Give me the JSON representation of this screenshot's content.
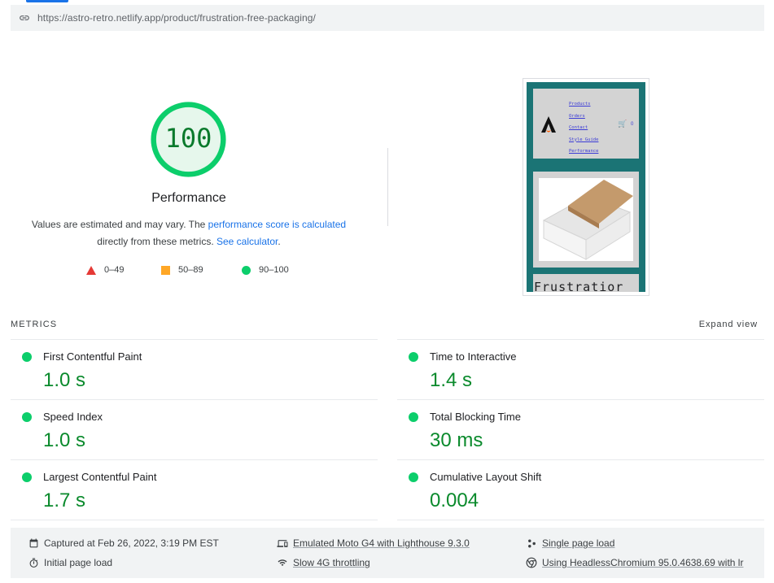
{
  "url": "https://astro-retro.netlify.app/product/frustration-free-packaging/",
  "score": {
    "value": "100",
    "fraction": 1.0,
    "title": "Performance",
    "desc_prefix": "Values are estimated and may vary. The ",
    "desc_link": "performance score is calculated",
    "desc_mid": "directly from these metrics. ",
    "desc_link2": "See calculator",
    "desc_suffix": "."
  },
  "legend": {
    "fail": "0–49",
    "average": "50–89",
    "pass": "90–100"
  },
  "colors": {
    "pass": "#0cce6b",
    "average": "#ffa726",
    "fail": "#e53935",
    "link": "#1a73e8",
    "score_text": "#0a7a2c"
  },
  "thumbnail": {
    "nav": [
      "Products",
      "Orders",
      "Contact",
      "Style Guide",
      "Performance"
    ],
    "cart_count": "0",
    "product_title": "Frustratior"
  },
  "metrics": {
    "header": "METRICS",
    "expand": "Expand view",
    "items": [
      {
        "label": "First Contentful Paint",
        "value": "1.0 s"
      },
      {
        "label": "Time to Interactive",
        "value": "1.4 s"
      },
      {
        "label": "Speed Index",
        "value": "1.0 s"
      },
      {
        "label": "Total Blocking Time",
        "value": "30 ms"
      },
      {
        "label": "Largest Contentful Paint",
        "value": "1.7 s"
      },
      {
        "label": "Cumulative Layout Shift",
        "value": "0.004"
      }
    ]
  },
  "footer": {
    "captured": "Captured at Feb 26, 2022, 3:19 PM EST",
    "initial": "Initial page load",
    "device": "Emulated Moto G4 with Lighthouse 9.3.0",
    "throttling": "Slow 4G throttling",
    "session": "Single page load",
    "browser": "Using HeadlessChromium 95.0.4638.69 with lr"
  }
}
